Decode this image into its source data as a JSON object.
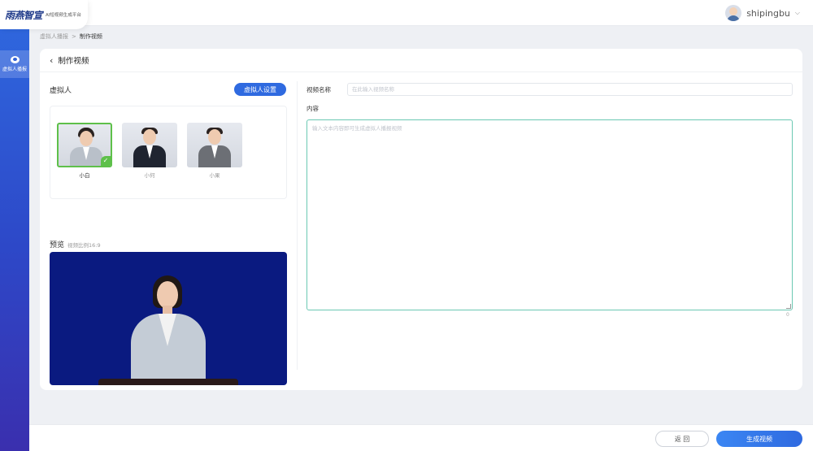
{
  "app": {
    "logo_text": "雨燕智宣",
    "logo_subtitle": "AI短视频生成平台"
  },
  "user": {
    "name": "shipingbu"
  },
  "sidebar": {
    "items": [
      {
        "label": "虚拟人播报",
        "icon": "chat-bubble-icon",
        "active": true
      }
    ]
  },
  "breadcrumb": {
    "items": [
      "虚拟人播报",
      "制作视频"
    ],
    "separator": ">"
  },
  "page": {
    "title": "制作视频"
  },
  "virtual_human": {
    "section_title": "虚拟人",
    "settings_button": "虚拟人设置",
    "avatars": [
      {
        "name": "小白",
        "selected": true
      },
      {
        "name": "小何",
        "selected": false
      },
      {
        "name": "小果",
        "selected": false
      }
    ]
  },
  "preview": {
    "title": "预览",
    "subtitle": "视频比例16:9",
    "background_color": "#0a1a80"
  },
  "form": {
    "video_name_label": "视频名称",
    "video_name_placeholder": "在此输入视频名称",
    "video_name_value": "",
    "content_label": "内容",
    "content_placeholder": "输入文本内容即可生成虚拟人播报视频",
    "content_value": "",
    "char_count": "0"
  },
  "footer": {
    "back_button": "返 回",
    "generate_button": "生成视频"
  },
  "colors": {
    "primary": "#2f6ae0",
    "selected_border": "#5ec04a",
    "textarea_focus": "#6bc8b3"
  }
}
